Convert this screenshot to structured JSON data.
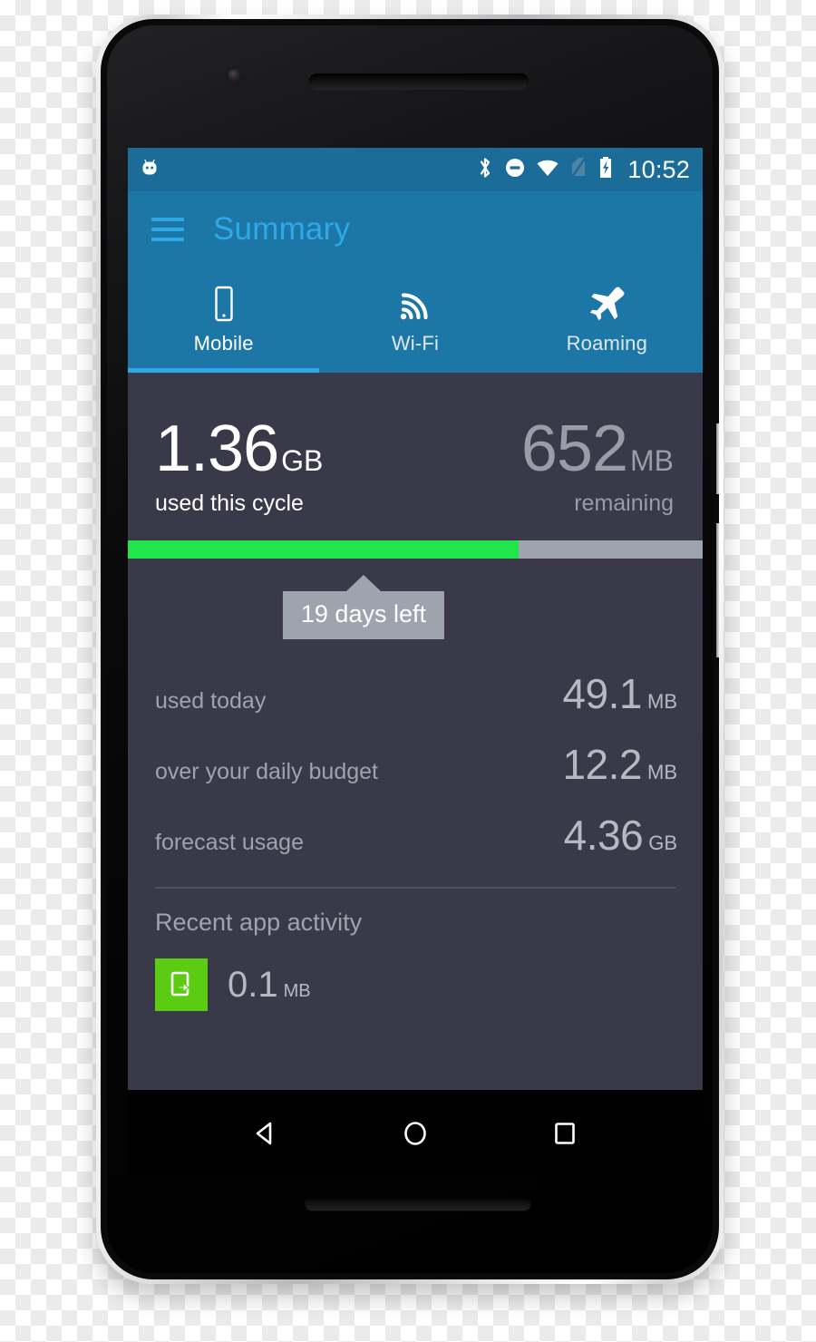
{
  "status_bar": {
    "notification_icon": "android-robot-icon",
    "icons": [
      "bluetooth-icon",
      "do-not-disturb-icon",
      "wifi-icon",
      "no-sim-icon",
      "battery-charging-icon"
    ],
    "clock": "10:52"
  },
  "app_bar": {
    "menu_icon": "hamburger-menu-icon",
    "title": "Summary"
  },
  "tabs": [
    {
      "label": "Mobile",
      "icon": "mobile-phone-icon",
      "active": true
    },
    {
      "label": "Wi-Fi",
      "icon": "wifi-signal-icon",
      "active": false
    },
    {
      "label": "Roaming",
      "icon": "airplane-icon",
      "active": false
    }
  ],
  "hero": {
    "used": {
      "number": "1.36",
      "unit": "GB",
      "caption": "used this cycle"
    },
    "remaining": {
      "number": "652",
      "unit": "MB",
      "caption": "remaining"
    }
  },
  "progress": {
    "percent": 68,
    "fill_color": "#21e64b",
    "track_color": "#9fa3ad",
    "marker_label": "19 days left",
    "marker_position_percent": 41
  },
  "stats": [
    {
      "label": "used today",
      "number": "49.1",
      "unit": "MB"
    },
    {
      "label": "over your daily budget",
      "number": "12.2",
      "unit": "MB"
    },
    {
      "label": "forecast usage",
      "number": "4.36",
      "unit": "GB"
    }
  ],
  "recent": {
    "section_title": "Recent app activity",
    "items": [
      {
        "icon": "data-usage-app-icon",
        "icon_color": "#5bcc12",
        "number": "0.1",
        "unit": "MB"
      }
    ]
  },
  "nav_bar": {
    "back": "back-triangle-icon",
    "home": "home-circle-icon",
    "recents": "recents-square-icon"
  },
  "theme": {
    "status_bar_bg": "#1b6c98",
    "app_bar_bg": "#1d77a6",
    "accent": "#2fa8e8",
    "screen_bg": "#393949"
  }
}
